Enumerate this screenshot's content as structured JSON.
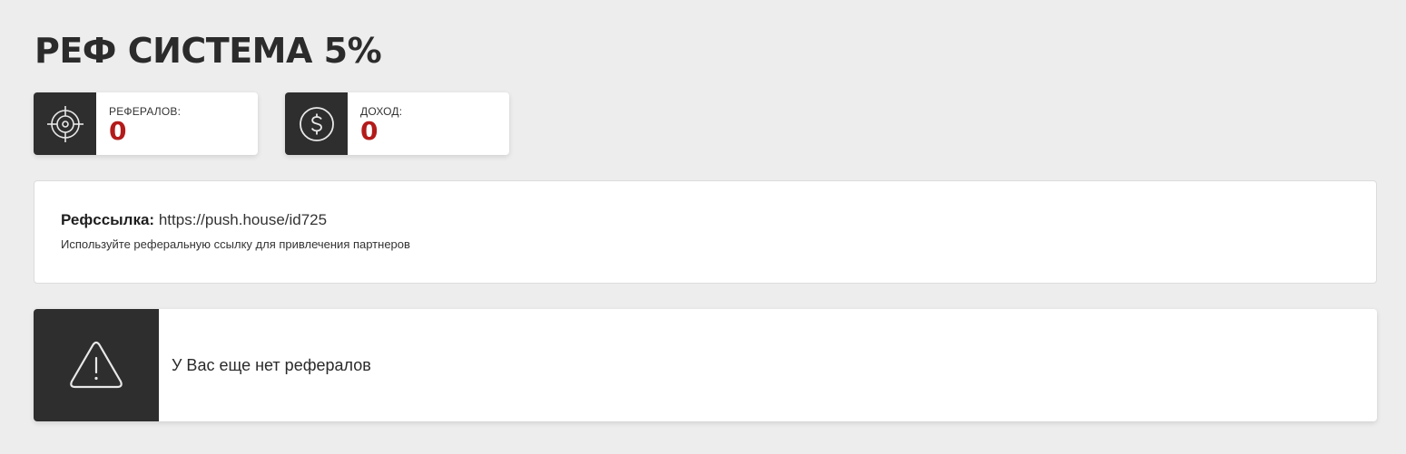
{
  "page": {
    "title": "РЕФ СИСТЕМА 5%"
  },
  "stats": {
    "referrals": {
      "label": "РЕФЕРАЛОВ:",
      "value": "0",
      "icon": "target-icon"
    },
    "income": {
      "label": "ДОХОД:",
      "value": "0",
      "icon": "dollar-coin-icon"
    }
  },
  "referral_link": {
    "label": "Рефссылка:",
    "url": "https://push.house/id725",
    "hint": "Используйте реферальную ссылку для привлечения партнеров"
  },
  "alert": {
    "icon": "warning-icon",
    "message": "У Вас еще нет рефералов"
  },
  "colors": {
    "background": "#ededed",
    "icon_box": "#2e2e2e",
    "value_accent": "#b31b1b",
    "card": "#ffffff"
  }
}
